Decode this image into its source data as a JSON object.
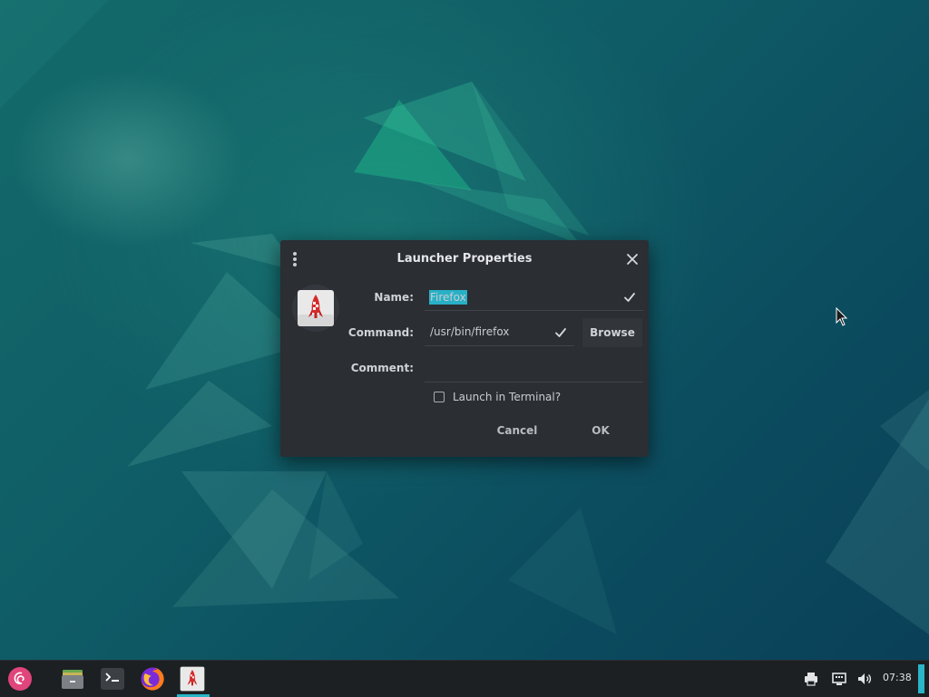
{
  "dialog": {
    "title": "Launcher Properties",
    "fields": {
      "name_label": "Name:",
      "name_value": "Firefox",
      "command_label": "Command:",
      "command_value": "/usr/bin/firefox",
      "comment_label": "Comment:",
      "comment_value": ""
    },
    "browse_label": "Browse",
    "terminal_label": "Launch in Terminal?",
    "terminal_checked": false,
    "cancel_label": "Cancel",
    "ok_label": "OK"
  },
  "taskbar": {
    "apps": [
      {
        "name": "debian-menu-icon"
      },
      {
        "name": "file-manager-icon"
      },
      {
        "name": "terminal-icon"
      },
      {
        "name": "firefox-icon"
      },
      {
        "name": "launcher-rocket-icon"
      }
    ],
    "tray": [
      "printer-icon",
      "network-icon",
      "volume-icon"
    ],
    "clock": "07:38"
  },
  "colors": {
    "accent": "#2ab5c8",
    "dialog_bg": "#2b2e33",
    "taskbar_bg": "#1d2023",
    "selection": "#28b0c6"
  }
}
